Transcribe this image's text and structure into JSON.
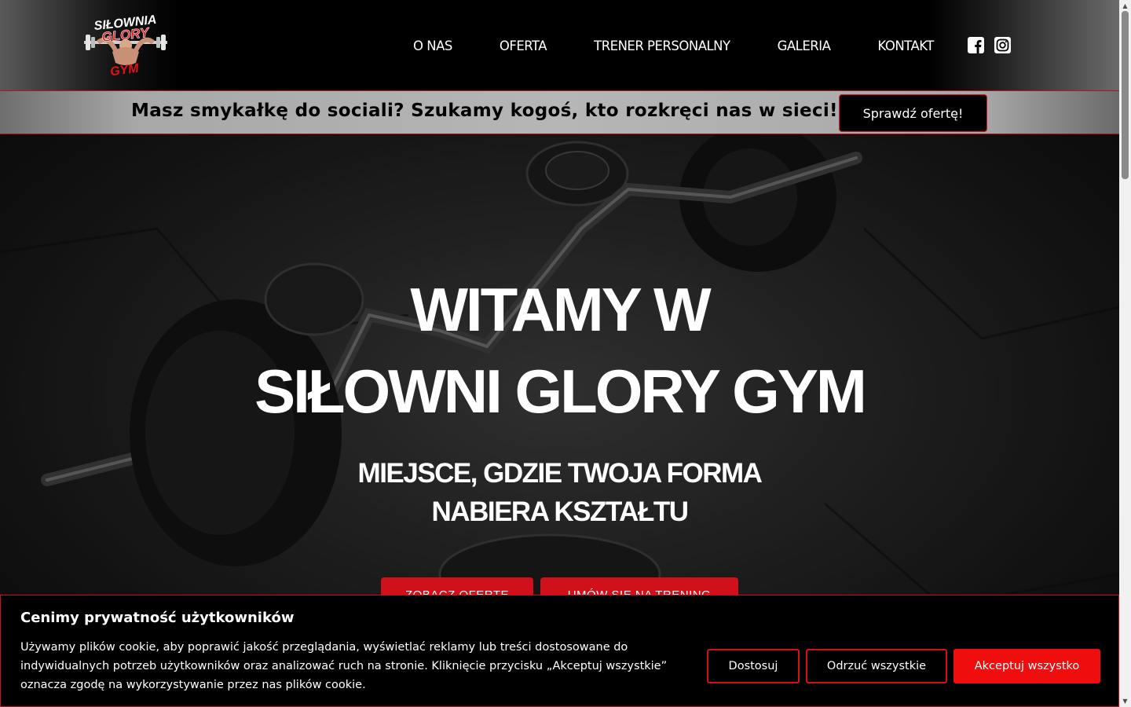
{
  "header": {
    "logo_text": [
      "SIŁOWNIA",
      "GLORY",
      "GYM"
    ],
    "nav": [
      "O NAS",
      "OFERTA",
      "TRENER PERSONALNY",
      "GALERIA",
      "KONTAKT"
    ],
    "social_icons": [
      "facebook-icon",
      "instagram-icon"
    ]
  },
  "announcement": {
    "text": "Masz smykałkę do sociali? Szukamy kogoś, kto rozkręci nas w sieci!",
    "button": "Sprawdź ofertę!"
  },
  "hero": {
    "title_line1": "WITAMY W",
    "title_line2": "SIŁOWNI GLORY GYM",
    "subtitle_line1": "MIEJSCE, GDZIE TWOJA FORMA",
    "subtitle_line2": "NABIERA KSZTAŁTU",
    "button_offer": "ZOBACZ OFERTĘ",
    "button_training": "UMÓW SIĘ NA TRENING"
  },
  "cookie": {
    "title": "Cenimy prywatność użytkowników",
    "text": "Używamy plików cookie, aby poprawić jakość przeglądania, wyświetlać reklamy lub treści dostosowane do indywidualnych potrzeb użytkowników oraz analizować ruch na stronie. Kliknięcie przycisku „Akceptuj wszystkie” oznacza zgodę na wykorzystywanie przez nas plików cookie.",
    "customize": "Dostosuj",
    "reject": "Odrzuć wszystkie",
    "accept": "Akceptuj wszystko"
  },
  "colors": {
    "accent_red": "#d0101a",
    "accept_red": "#f00d0d",
    "announce_gray": "#b6b6b6"
  }
}
